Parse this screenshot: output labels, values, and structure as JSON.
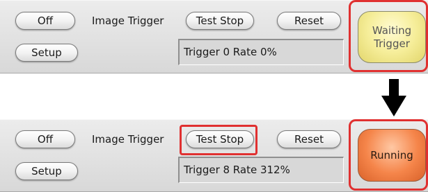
{
  "before": {
    "off_label": "Off",
    "setup_label": "Setup",
    "mode_label": "Image Trigger",
    "test_stop_label": "Test Stop",
    "reset_label": "Reset",
    "readout": "Trigger 0 Rate 0%",
    "status_line1": "Waiting",
    "status_line2": "Trigger",
    "status_color": "#f6ee9a"
  },
  "after": {
    "off_label": "Off",
    "setup_label": "Setup",
    "mode_label": "Image Trigger",
    "test_stop_label": "Test Stop",
    "reset_label": "Reset",
    "readout": "Trigger 8 Rate 312%",
    "status": "Running",
    "status_color": "#f5854a"
  },
  "highlight_color": "#e03030",
  "arrow": "down-arrow"
}
